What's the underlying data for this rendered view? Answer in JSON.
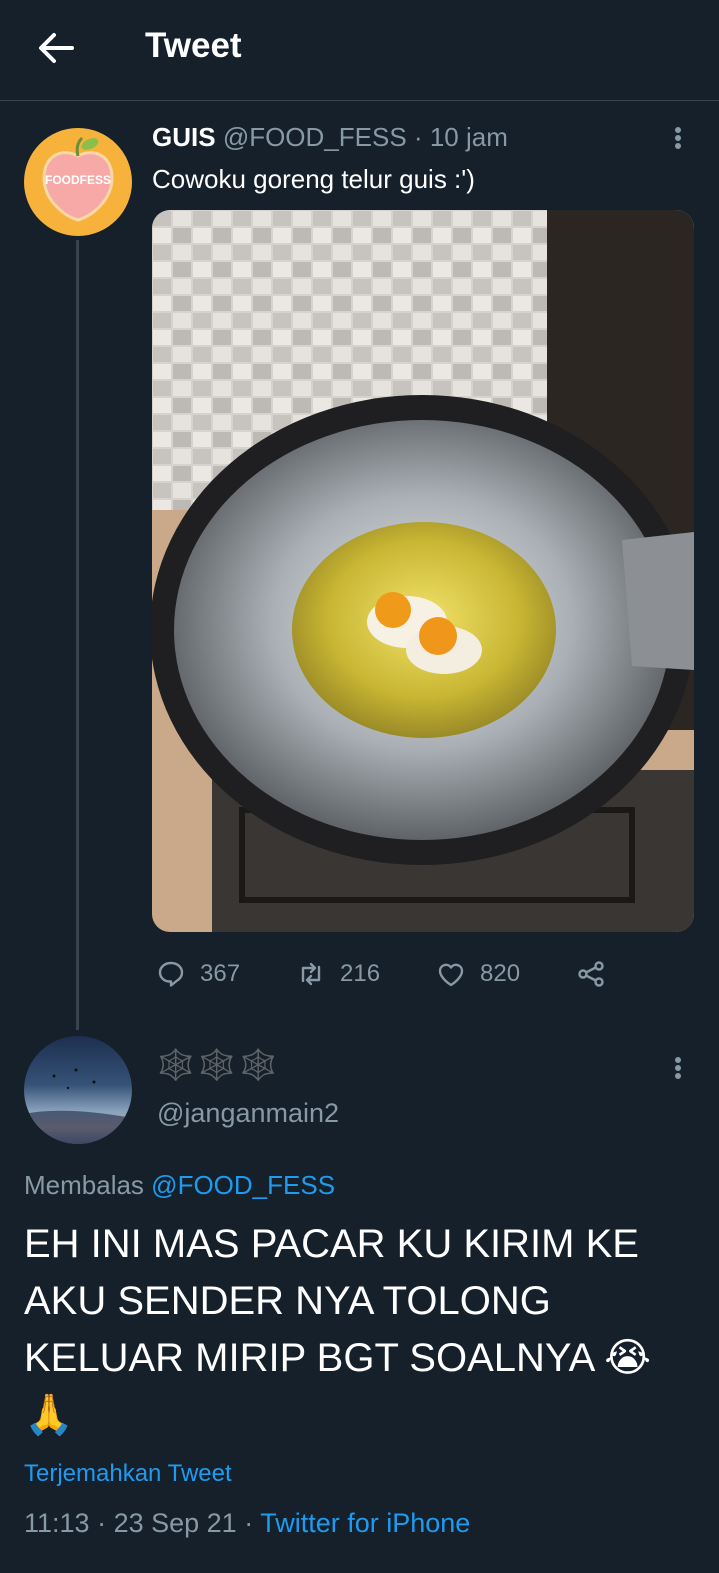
{
  "header": {
    "title": "Tweet"
  },
  "tweet": {
    "author_name": "GUIS",
    "author_handle": "@FOOD_FESS",
    "separator": "·",
    "time": "10 jam",
    "text": "Cowoku goreng telur guis :')",
    "avatar_logo_text": "FOODFESS",
    "stats": {
      "replies": "367",
      "retweets": "216",
      "likes": "820"
    }
  },
  "reply": {
    "display_name": "🕸️🕸️🕸️",
    "handle": "@janganmain2",
    "replying_prefix": "Membalas",
    "replying_to": "@FOOD_FESS",
    "text": "EH INI MAS PACAR KU KIRIM KE AKU SENDER NYA TOLONG KELUAR MIRIP BGT SOALNYA 😭 🙏",
    "translate_label": "Terjemahkan Tweet",
    "time": "11:13",
    "date": "23 Sep 21",
    "source": "Twitter for iPhone",
    "separator": "·"
  },
  "colors": {
    "background": "#15202b",
    "divider": "#38444d",
    "secondary_text": "#8899a6",
    "link": "#1d9bf0",
    "avatar_orange": "#f6b23a"
  },
  "icons": [
    "back-arrow-icon",
    "more-vertical-icon",
    "reply-icon",
    "retweet-icon",
    "like-icon",
    "share-icon"
  ]
}
